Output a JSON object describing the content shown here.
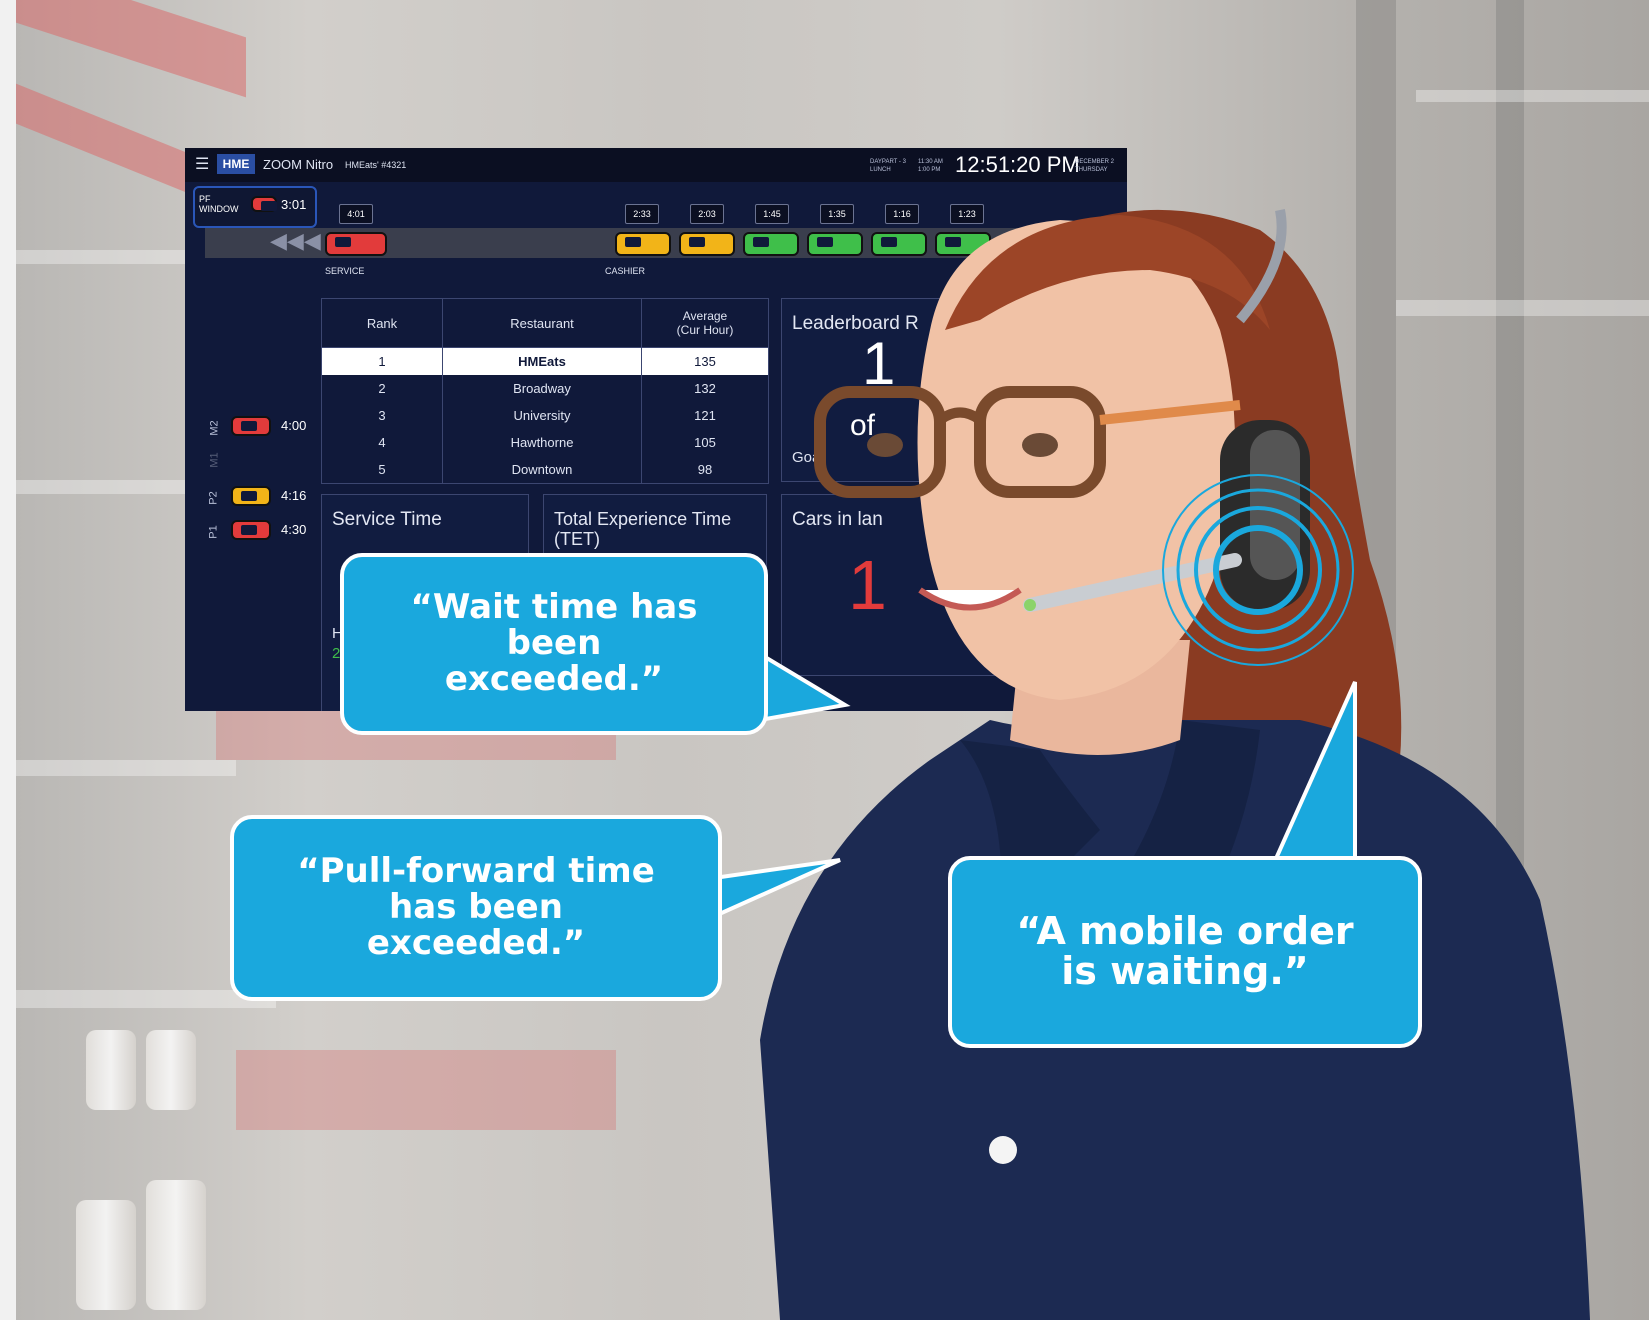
{
  "dashboard": {
    "brand": "HME",
    "app_name": "ZOOM Nitro",
    "trademark": "®",
    "store": "HMEats' #4321",
    "daypart": "DAYPART - 3",
    "daypart_name": "LUNCH",
    "daypart_start": "11:30 AM",
    "daypart_end": "1:00 PM",
    "clock": "12:51:20 PM",
    "date": "DECEMBER 2",
    "weekday": "THURSDAY",
    "pf_label_1": "PF",
    "pf_label_2": "WINDOW",
    "pf_time": "3:01",
    "lane": {
      "service_label": "SERVICE",
      "cashier_label": "CASHIER",
      "service_timer": "4:01",
      "queue_timers": [
        "2:33",
        "2:03",
        "1:45",
        "1:35",
        "1:16",
        "1:23"
      ]
    },
    "side_lanes": [
      {
        "label": "M2",
        "time": "4:00"
      },
      {
        "label": "M1",
        "time": ""
      },
      {
        "label": "P2",
        "time": "4:16"
      },
      {
        "label": "P1",
        "time": "4:30"
      }
    ],
    "rank_table": {
      "headers": [
        "Rank",
        "Restaurant",
        "Average\n(Cur Hour)"
      ],
      "rows": [
        [
          "1",
          "HMEats",
          "135"
        ],
        [
          "2",
          "Broadway",
          "132"
        ],
        [
          "3",
          "University",
          "121"
        ],
        [
          "4",
          "Hawthorne",
          "105"
        ],
        [
          "5",
          "Downtown",
          "98"
        ]
      ]
    },
    "leaderboard_title": "Leaderboard R",
    "leaderboard_big": "1",
    "leaderboard_of": "of",
    "leaderboard_goal": "Goal",
    "service_time_title": "Service Time",
    "service_time_foot": "H",
    "service_time_foot2": "2",
    "tet_title": "Total Experience Time (TET)",
    "cars_title": "Cars in lan",
    "cars_value": "1"
  },
  "bubbles": {
    "wait": "“Wait time has been exceeded.”",
    "pull": "“Pull-forward time has been exceeded.”",
    "mobile": "“A mobile order is waiting.”"
  },
  "colors": {
    "bubble": "#1aa8dd",
    "dash_bg": "#10193a",
    "car_red": "#e23b3b",
    "car_yellow": "#f2b418",
    "car_green": "#3fbf4a"
  }
}
